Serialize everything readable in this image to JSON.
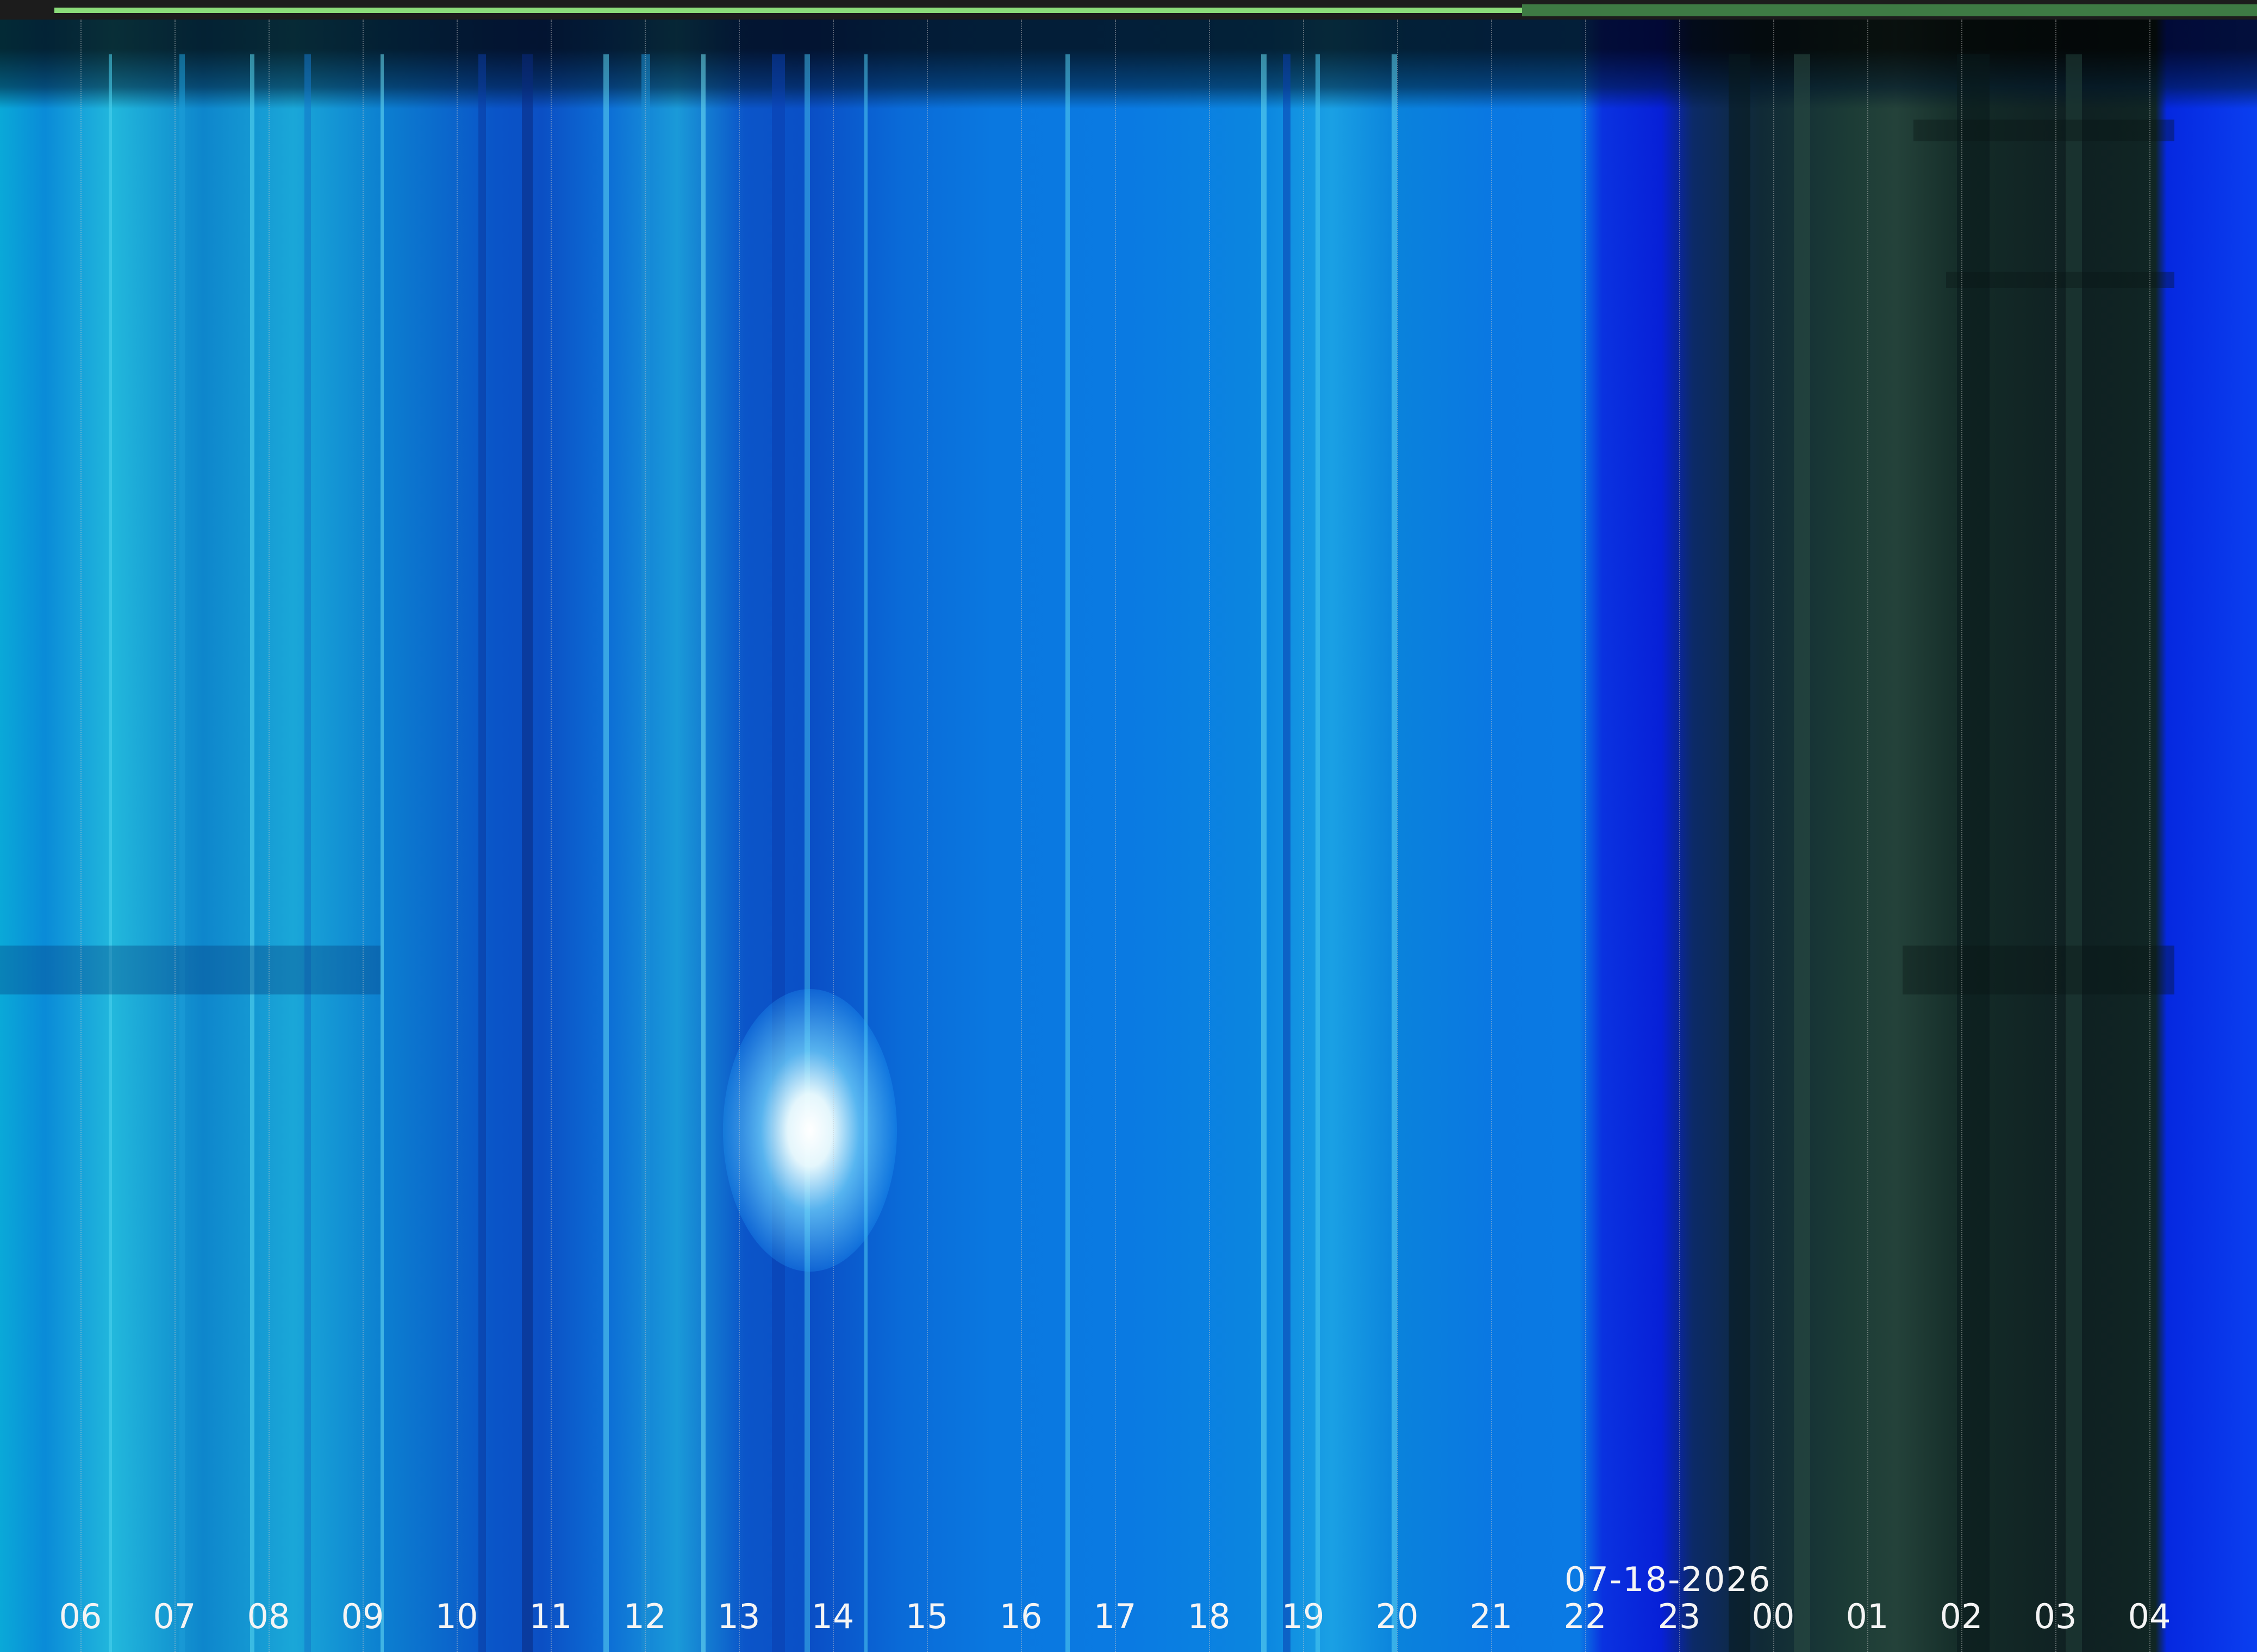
{
  "keogram": {
    "date": "07-18-2026",
    "hours": [
      "06",
      "07",
      "08",
      "09",
      "10",
      "11",
      "12",
      "13",
      "14",
      "15",
      "16",
      "17",
      "18",
      "19",
      "20",
      "21",
      "22",
      "23",
      "00",
      "01",
      "02",
      "03",
      "04"
    ],
    "colors": {
      "day_sky": "#0a7ae2",
      "night_sky": "#102624",
      "twilight_blue": "#0720d8",
      "sun": "#ffffff",
      "label_text": "#f4f4f4",
      "status_bar": "#8bdc7a"
    }
  }
}
